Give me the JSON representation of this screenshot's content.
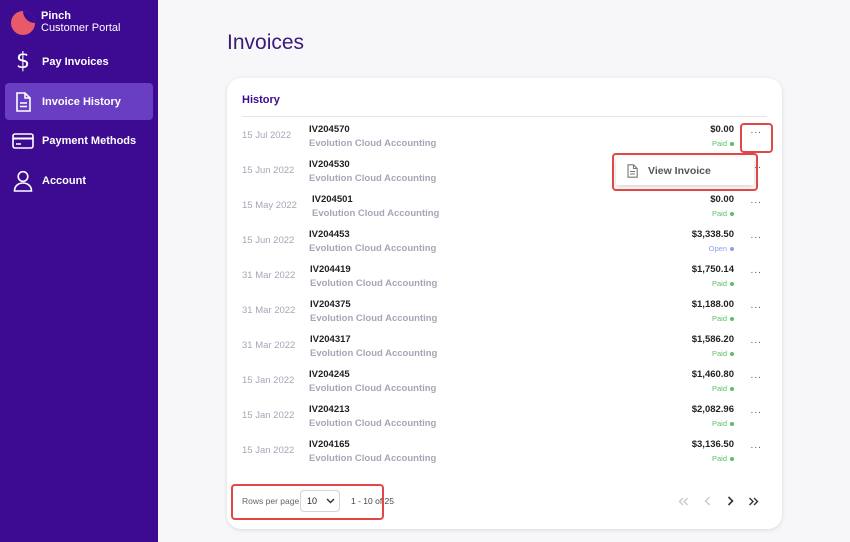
{
  "brand": {
    "name": "Pinch",
    "subtitle": "Customer Portal"
  },
  "sidebar": {
    "items": [
      {
        "label": "Pay Invoices",
        "icon": "dollar-icon",
        "active": false
      },
      {
        "label": "Invoice History",
        "icon": "document-icon",
        "active": true
      },
      {
        "label": "Payment Methods",
        "icon": "credit-card-icon",
        "active": false
      },
      {
        "label": "Account",
        "icon": "user-icon",
        "active": false
      }
    ]
  },
  "page": {
    "title": "Invoices"
  },
  "history": {
    "title": "History",
    "rows": [
      {
        "date": "15 Jul 2022",
        "number": "IV204570",
        "client": "Evolution Cloud Accounting",
        "amount": "$0.00",
        "status": "Paid"
      },
      {
        "date": "15 Jun 2022",
        "number": "IV204530",
        "client": "Evolution Cloud Accounting",
        "amount": "",
        "status": ""
      },
      {
        "date": "15 May 2022",
        "number": "IV204501",
        "client": "Evolution Cloud Accounting",
        "amount": "$0.00",
        "status": "Paid"
      },
      {
        "date": "15 Jun 2022",
        "number": "IV204453",
        "client": "Evolution Cloud Accounting",
        "amount": "$3,338.50",
        "status": "Open"
      },
      {
        "date": "31 Mar 2022",
        "number": "IV204419",
        "client": "Evolution Cloud Accounting",
        "amount": "$1,750.14",
        "status": "Paid"
      },
      {
        "date": "31 Mar 2022",
        "number": "IV204375",
        "client": "Evolution Cloud Accounting",
        "amount": "$1,188.00",
        "status": "Paid"
      },
      {
        "date": "31 Mar 2022",
        "number": "IV204317",
        "client": "Evolution Cloud Accounting",
        "amount": "$1,586.20",
        "status": "Paid"
      },
      {
        "date": "15 Jan 2022",
        "number": "IV204245",
        "client": "Evolution Cloud Accounting",
        "amount": "$1,460.80",
        "status": "Paid"
      },
      {
        "date": "15 Jan 2022",
        "number": "IV204213",
        "client": "Evolution Cloud Accounting",
        "amount": "$2,082.96",
        "status": "Paid"
      },
      {
        "date": "15 Jan 2022",
        "number": "IV204165",
        "client": "Evolution Cloud Accounting",
        "amount": "$3,136.50",
        "status": "Paid"
      }
    ],
    "more_glyph": "···"
  },
  "dropdown": {
    "label": "View Invoice",
    "icon": "document-icon"
  },
  "pagination": {
    "rows_per_page_label": "Rows per page",
    "rows_per_page_value": "10",
    "range": "1 - 10 of 25",
    "buttons": [
      "first-page-icon",
      "prev-page-icon",
      "next-page-icon",
      "last-page-icon"
    ]
  },
  "colors": {
    "sidebar": "#3d0a92",
    "sidebar_active": "#6a3ec2",
    "accent": "#3d0a92",
    "paid": "#5cbf6a",
    "open": "#8aa2ee",
    "highlight": "#e04848"
  }
}
